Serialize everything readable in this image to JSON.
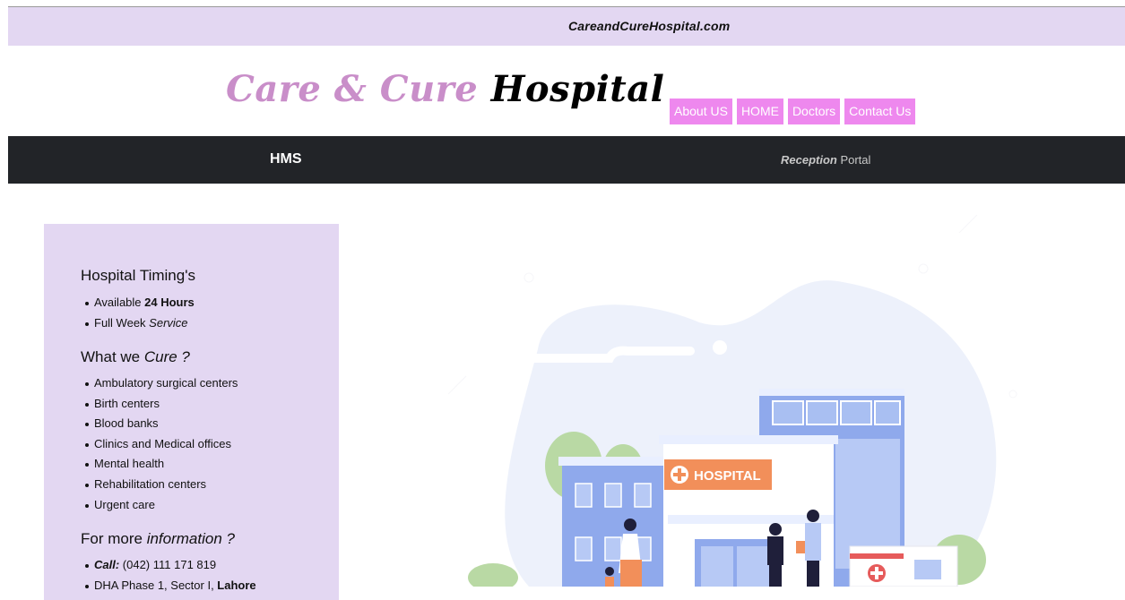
{
  "topbar": {
    "text": "CareandCureHospital.com"
  },
  "logo": {
    "part1": "Care & Cure",
    "part2": "Hospital"
  },
  "nav": {
    "items": [
      "About US",
      "HOME",
      "Doctors",
      "Contact Us"
    ]
  },
  "navbar": {
    "brand": "HMS",
    "portal_bold": "Reception",
    "portal_rest": " Portal"
  },
  "sidebar": {
    "timing_heading": "Hospital Timing's",
    "timing_items": [
      {
        "pre": "Available ",
        "emph": "24 Hours",
        "style": "bold"
      },
      {
        "pre": "Full Week ",
        "emph": "Service",
        "style": "italic"
      }
    ],
    "cure_heading_pre": "What we ",
    "cure_heading_emph": "Cure ?",
    "cure_items": [
      "Ambulatory surgical centers",
      "Birth centers",
      "Blood banks",
      "Clinics and Medical offices",
      "Mental health",
      "Rehabilitation centers",
      "Urgent care"
    ],
    "info_heading_pre": "For more ",
    "info_heading_emph": "information ?",
    "info_items": [
      {
        "label": "Call:",
        "text": " (042) 111 171 819"
      },
      {
        "label": "",
        "text": "DHA Phase 1, Sector I, ",
        "bold_tail": "Lahore"
      }
    ]
  },
  "illustration": {
    "sign_text": "HOSPITAL"
  },
  "colors": {
    "topbar_bg": "#e3d7f2",
    "nav_bg": "#ee88ee",
    "dark_bar": "#222428",
    "logo_pink": "#c98ec9",
    "sign_orange": "#f28f5a",
    "building_blue": "#8fa9ec"
  }
}
